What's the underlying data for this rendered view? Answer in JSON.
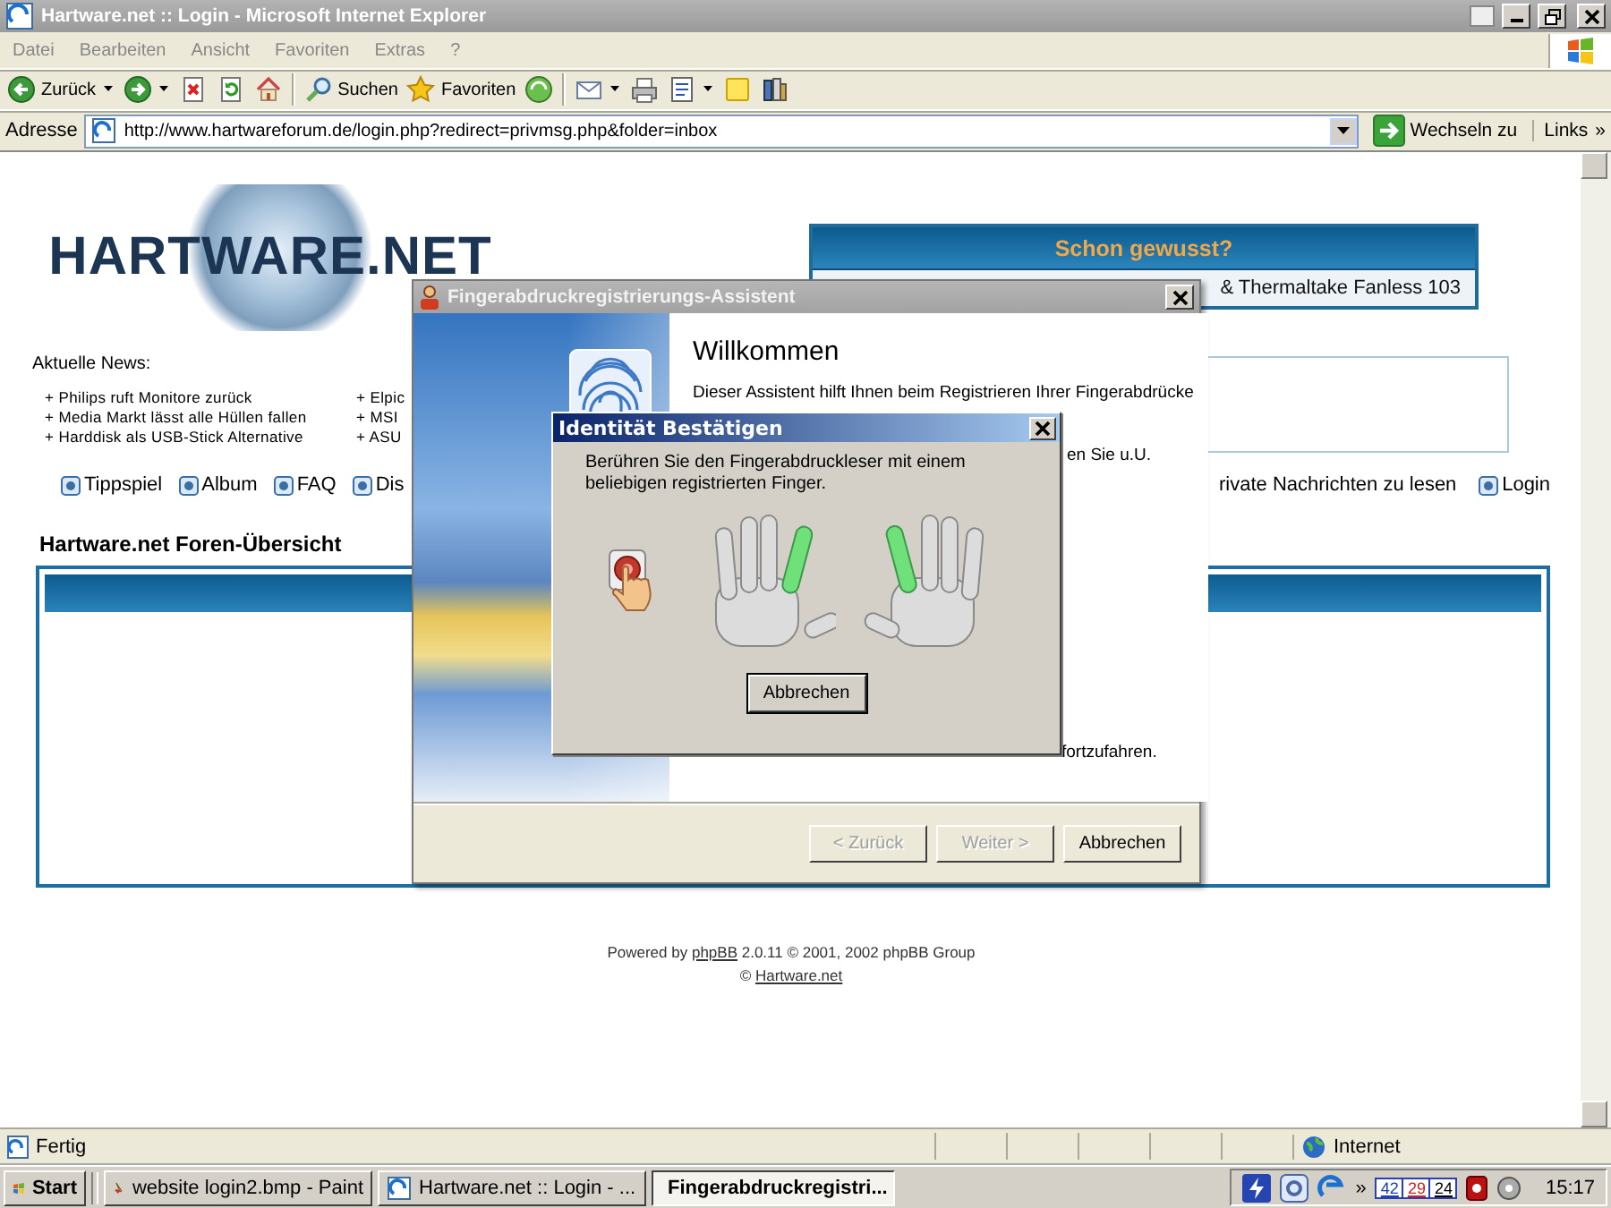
{
  "browser": {
    "title": "Hartware.net :: Login - Microsoft Internet Explorer",
    "menu": [
      "Datei",
      "Bearbeiten",
      "Ansicht",
      "Favoriten",
      "Extras",
      "?"
    ],
    "toolbar": [
      {
        "kind": "back",
        "label": "Zurück",
        "dropdown": true
      },
      {
        "kind": "forward",
        "dropdown": true
      },
      {
        "kind": "stop",
        "dropdown": false
      },
      {
        "kind": "refresh",
        "dropdown": false
      },
      {
        "kind": "home",
        "dropdown": false
      },
      {
        "kind": "search",
        "label": "Suchen",
        "dropdown": false
      },
      {
        "kind": "favorites",
        "label": "Favoriten",
        "dropdown": false
      },
      {
        "kind": "media",
        "dropdown": false
      },
      {
        "kind": "mail",
        "dropdown": true
      },
      {
        "kind": "print",
        "dropdown": false
      },
      {
        "kind": "edit",
        "dropdown": true
      },
      {
        "kind": "note",
        "dropdown": false
      },
      {
        "kind": "research",
        "dropdown": false
      }
    ],
    "address": {
      "label": "Adresse",
      "url": "http://www.hartwareforum.de/login.php?redirect=privmsg.php&folder=inbox",
      "go": "Wechseln zu",
      "links": "Links",
      "links_more": "»"
    },
    "status_bar": {
      "text": "Fertig",
      "zone": "Internet"
    }
  },
  "page": {
    "logo": "HARTWARE.NET",
    "tip": {
      "title": "Schon gewusst?",
      "text": "& Thermaltake Fanless 103"
    },
    "news": {
      "heading": "Aktuelle News:",
      "columns": [
        [
          "+ Philips ruft Monitore zurück",
          "+ Media Markt lässt alle Hüllen fallen",
          "+ Harddisk als USB-Stick Alternative"
        ],
        [
          "+ Elpic",
          "+ MSI",
          "+ ASU"
        ]
      ]
    },
    "nav_left": [
      {
        "label": "Tippspiel"
      },
      {
        "label": "Album"
      },
      {
        "label": "FAQ"
      },
      {
        "label": "Dis"
      }
    ],
    "nav_right": [
      {
        "label": "rivate Nachrichten zu lesen",
        "icon": false
      },
      {
        "label": "Login",
        "icon": true
      }
    ],
    "forum_heading": "Hartware.net Foren-Übersicht",
    "footer": {
      "prefix": "Powered by",
      "link": "phpBB",
      "suffix": "2.0.11 © 2001, 2002 phpBB Group",
      "copyright": "©",
      "site_link": "Hartware.net"
    }
  },
  "wizard": {
    "title": "Fingerabdruckregistrierungs-Assistent",
    "heading": "Willkommen",
    "intro": "Dieser Assistent hilft Ihnen beim Registrieren Ihrer Fingerabdrücke",
    "line_2": "en Sie u.U.",
    "line_3": "fortzufahren.",
    "buttons": [
      {
        "label": "< Zurück",
        "disabled": true
      },
      {
        "label": "Weiter >",
        "disabled": true
      },
      {
        "label": "Abbrechen",
        "disabled": false
      }
    ]
  },
  "confirm": {
    "title": "Identität Bestätigen",
    "message": "Berühren Sie den Fingerabdruckleser mit einem beliebigen registrierten Finger.",
    "hands": [
      {
        "fingers": [
          {
            "enrolled": false
          },
          {
            "enrolled": false
          },
          {
            "enrolled": false
          },
          {
            "enrolled": true
          },
          {
            "enrolled": false
          }
        ]
      },
      {
        "fingers": [
          {
            "enrolled": false
          },
          {
            "enrolled": true
          },
          {
            "enrolled": false
          },
          {
            "enrolled": false
          },
          {
            "enrolled": false
          }
        ]
      }
    ],
    "button": "Abbrechen"
  },
  "taskbar": {
    "start": "Start",
    "tasks": [
      {
        "label": "website login2.bmp - Paint",
        "selected": false
      },
      {
        "label": "Hartware.net :: Login - ...",
        "selected": false
      },
      {
        "label": "Fingerabdruckregistri...",
        "selected": true
      }
    ],
    "more": "»",
    "readings": [
      "42",
      "29",
      "24"
    ],
    "clock": "15:17"
  }
}
